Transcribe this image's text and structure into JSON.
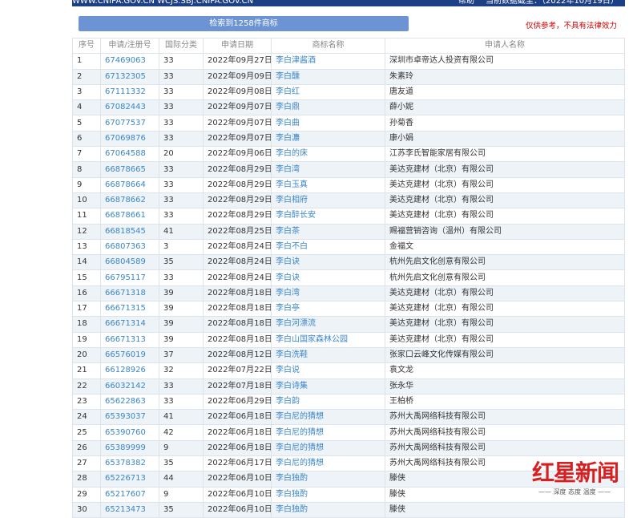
{
  "header": {
    "site": "WWW.CNIPA.GOV.CN WCJS.SBJ.CNIPA.GOV.CN",
    "help": "帮助",
    "as_of": "当前数据截至：（2022年10月19日）"
  },
  "summary": "检索到1258件商标",
  "disclaimer": "仅供参考，不具有法律效力",
  "columns": [
    "序号",
    "申请/注册号",
    "国际分类",
    "申请日期",
    "商标名称",
    "申请人名称"
  ],
  "rows": [
    [
      "1",
      "67469063",
      "33",
      "2022年09月27日",
      "李白津酱酒",
      "深圳市卓帝达人投资有限公司"
    ],
    [
      "2",
      "67132305",
      "33",
      "2022年09月09日",
      "李白醺",
      "朱素玲"
    ],
    [
      "3",
      "67111332",
      "33",
      "2022年09月08日",
      "李白红",
      "唐友道"
    ],
    [
      "4",
      "67082443",
      "33",
      "2022年09月07日",
      "李白鼎",
      "薛小妮"
    ],
    [
      "5",
      "67077537",
      "33",
      "2022年09月07日",
      "李白曲",
      "孙菊香"
    ],
    [
      "6",
      "67069876",
      "33",
      "2022年09月07日",
      "李白灋",
      "康小娟"
    ],
    [
      "7",
      "67064588",
      "20",
      "2022年09月06日",
      "李白的床",
      "江苏李氏智能家居有限公司"
    ],
    [
      "8",
      "66878665",
      "33",
      "2022年08月29日",
      "李白湾",
      "美达克建材（北京）有限公司"
    ],
    [
      "9",
      "66878664",
      "33",
      "2022年08月29日",
      "李白玉真",
      "美达克建材（北京）有限公司"
    ],
    [
      "10",
      "66878662",
      "33",
      "2022年08月29日",
      "李白相府",
      "美达克建材（北京）有限公司"
    ],
    [
      "11",
      "66878661",
      "33",
      "2022年08月29日",
      "李白醉长安",
      "美达克建材（北京）有限公司"
    ],
    [
      "12",
      "66818545",
      "41",
      "2022年08月25日",
      "李白茶",
      "赐福营销咨询（温州）有限公司"
    ],
    [
      "13",
      "66807363",
      "3",
      "2022年08月24日",
      "李白不白",
      "金福文"
    ],
    [
      "14",
      "66804589",
      "35",
      "2022年08月24日",
      "李白诀",
      "杭州先启文化创意有限公司"
    ],
    [
      "15",
      "66795117",
      "33",
      "2022年08月24日",
      "李白诀",
      "杭州先启文化创意有限公司"
    ],
    [
      "16",
      "66671318",
      "39",
      "2022年08月18日",
      "李白湾",
      "美达克建材（北京）有限公司"
    ],
    [
      "17",
      "66671315",
      "39",
      "2022年08月18日",
      "李白亭",
      "美达克建材（北京）有限公司"
    ],
    [
      "18",
      "66671314",
      "39",
      "2022年08月18日",
      "李白河漂流",
      "美达克建材（北京）有限公司"
    ],
    [
      "19",
      "66671313",
      "39",
      "2022年08月18日",
      "李白山国家森林公园",
      "美达克建材（北京）有限公司"
    ],
    [
      "20",
      "66576019",
      "37",
      "2022年08月12日",
      "李白洗鞋",
      "张家口云峰文化传媒有限公司"
    ],
    [
      "21",
      "66128926",
      "32",
      "2022年07月22日",
      "李白说",
      "袁文龙"
    ],
    [
      "22",
      "66032142",
      "33",
      "2022年07月18日",
      "李白诗集",
      "张永华"
    ],
    [
      "23",
      "65622863",
      "33",
      "2022年06月29日",
      "李白韵",
      "王柏桥"
    ],
    [
      "24",
      "65393037",
      "41",
      "2022年06月18日",
      "李白尼的猜想",
      "苏州大禹网络科技有限公司"
    ],
    [
      "25",
      "65390760",
      "42",
      "2022年06月18日",
      "李白尼的猜想",
      "苏州大禹网络科技有限公司"
    ],
    [
      "26",
      "65389999",
      "9",
      "2022年06月18日",
      "李白尼的猜想",
      "苏州大禹网络科技有限公司"
    ],
    [
      "27",
      "65378382",
      "35",
      "2022年06月17日",
      "李白尼的猜想",
      "苏州大禹网络科技有限公司"
    ],
    [
      "28",
      "65226713",
      "44",
      "2022年06月10日",
      "李白独酌",
      "滕侠"
    ],
    [
      "29",
      "65217607",
      "9",
      "2022年06月10日",
      "李白独酌",
      "滕侠"
    ],
    [
      "30",
      "65213473",
      "35",
      "2022年06月10日",
      "李白独酌",
      "滕侠"
    ]
  ],
  "watermark": {
    "name": "红星新闻",
    "slogan": "深度 态度 温度"
  }
}
